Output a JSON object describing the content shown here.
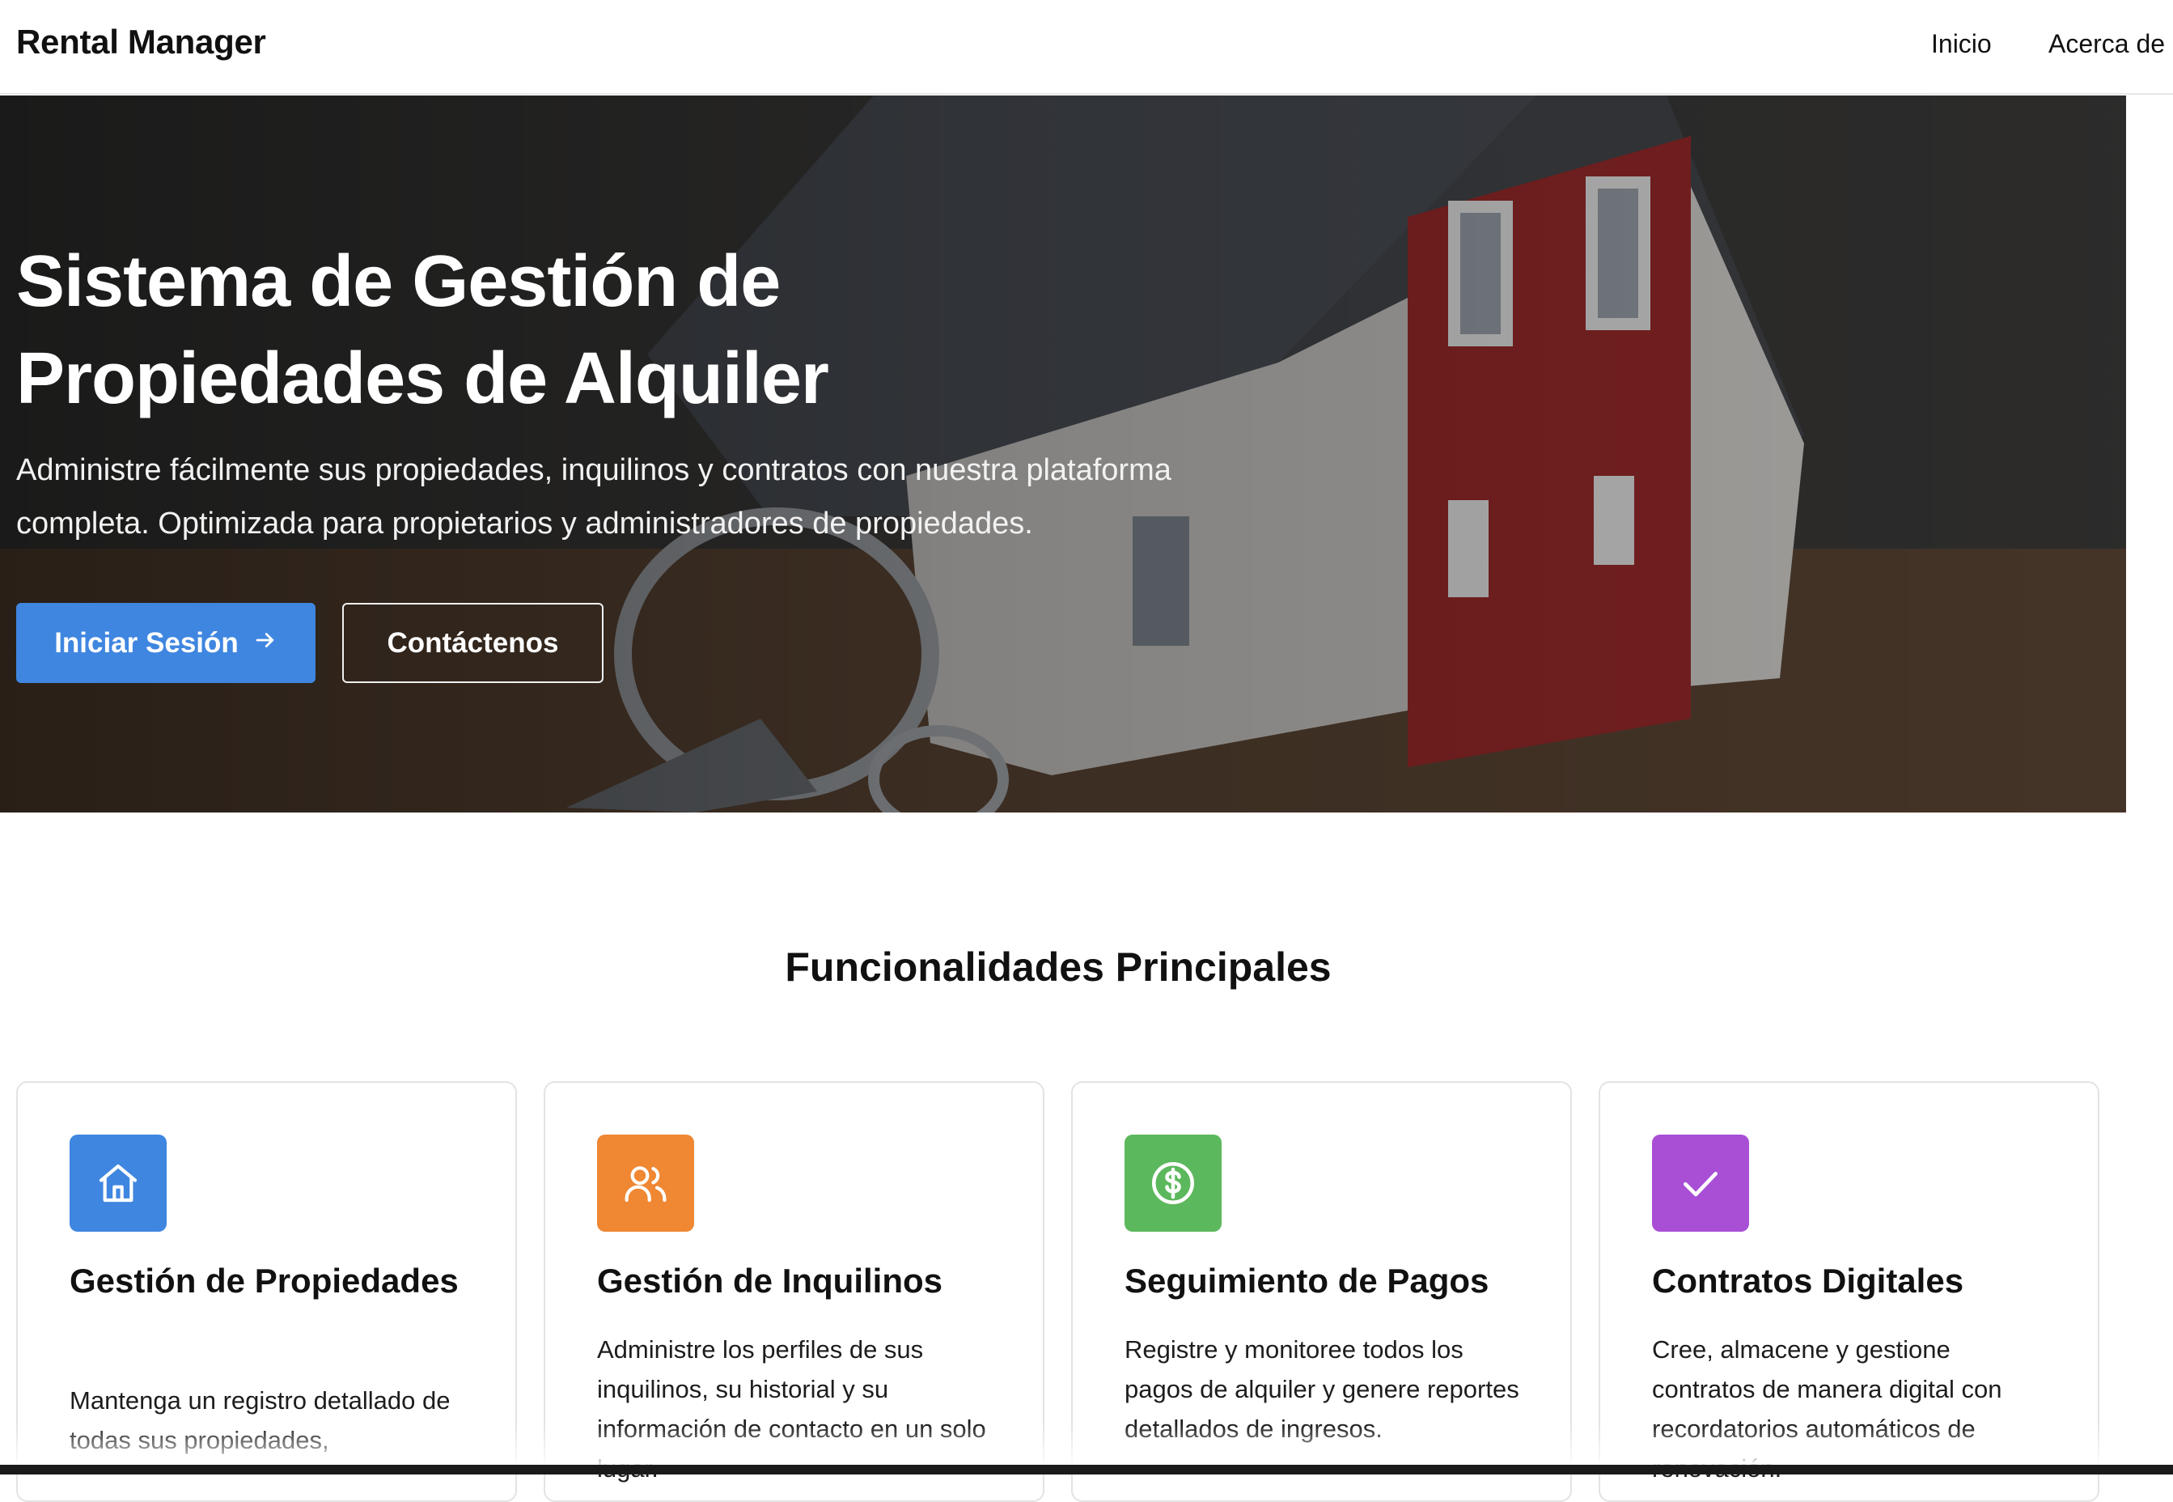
{
  "navbar": {
    "brand": "Rental Manager",
    "links": [
      "Inicio",
      "Acerca de"
    ]
  },
  "hero": {
    "title": "Sistema de Gestión de Propiedades de Alquiler",
    "subtitle": "Administre fácilmente sus propiedades, inquilinos y contratos con nuestra plataforma completa. Optimizada para propietarios y administradores de propiedades.",
    "primary_button": "Iniciar Sesión",
    "secondary_button": "Contáctenos"
  },
  "features": {
    "heading": "Funcionalidades Principales",
    "cards": [
      {
        "title": "Gestión de Propiedades",
        "description": "Mantenga un registro detallado de todas sus propiedades,",
        "icon": "home-icon",
        "color": "#3f86e0"
      },
      {
        "title": "Gestión de Inquilinos",
        "description": "Administre los perfiles de sus inquilinos, su historial y su información de contacto en un solo lugar.",
        "icon": "users-icon",
        "color": "#ef8733"
      },
      {
        "title": "Seguimiento de Pagos",
        "description": "Registre y monitoree todos los pagos de alquiler y genere reportes detallados de ingresos.",
        "icon": "dollar-icon",
        "color": "#5cb85c"
      },
      {
        "title": "Contratos Digitales",
        "description": "Cree, almacene y gestione contratos de manera digital con recordatorios automáticos de renovación.",
        "icon": "check-icon",
        "color": "#a84fd6"
      }
    ]
  }
}
